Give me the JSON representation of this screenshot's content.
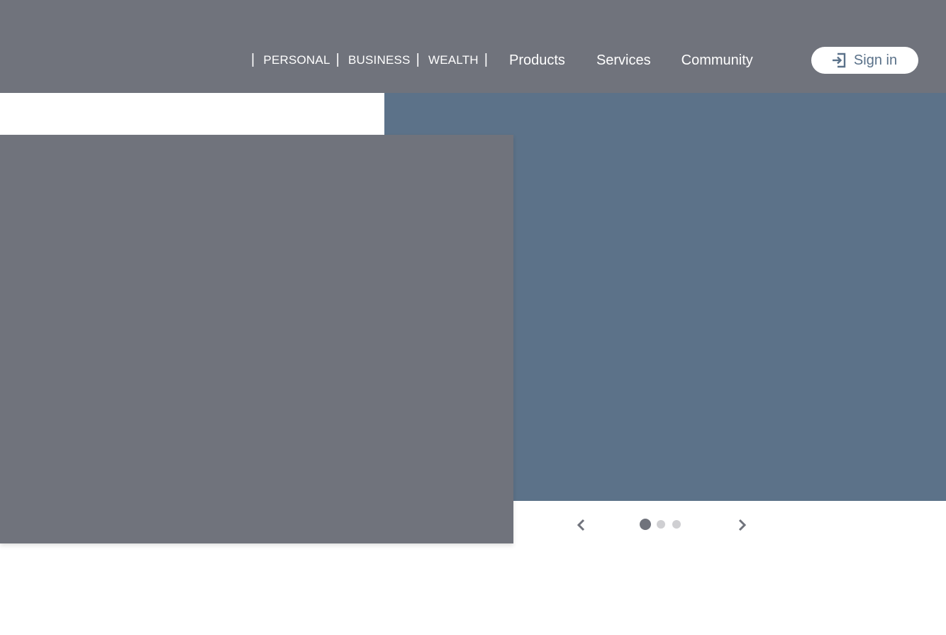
{
  "header": {
    "segments": [
      {
        "label": "PERSONAL"
      },
      {
        "label": "BUSINESS"
      },
      {
        "label": "WEALTH"
      }
    ],
    "separator": "|",
    "nav": [
      {
        "label": "Products"
      },
      {
        "label": "Services"
      },
      {
        "label": "Community"
      }
    ],
    "signin": {
      "label": "Sign in",
      "icon": "sign-in-icon"
    }
  },
  "carousel": {
    "prev_icon": "chevron-left-icon",
    "next_icon": "chevron-right-icon",
    "slide_count": 3,
    "active_index": 0
  },
  "colors": {
    "header_bg": "#70737c",
    "hero_blue": "#5c7289",
    "card_gray": "#70737c",
    "signin_text": "#5a7189",
    "dot_active": "#70737c",
    "dot_inactive": "#cfcfd2"
  }
}
